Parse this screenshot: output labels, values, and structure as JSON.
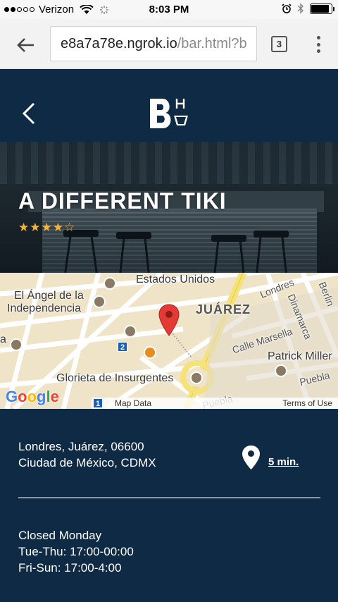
{
  "status_bar": {
    "carrier": "Verizon",
    "time": "8:03 PM",
    "signal_bars": 2,
    "battery_level": 0.9
  },
  "browser": {
    "url_main": "e8a7a78e.ngrok.io",
    "url_rest": "/bar.html?b",
    "tab_count": "3"
  },
  "venue": {
    "name": "A DIFFERENT TIKI",
    "rating": 4,
    "rating_max": 5
  },
  "map": {
    "labels": {
      "estados_unidos": "Estados Unidos",
      "angel": "El Ángel de la",
      "independencia": "Independencia",
      "juarez": "JUÁREZ",
      "londres": "Londres",
      "dinamarca": "Dinamarca",
      "berlin": "Berlin",
      "calle_marsella": "Calle Marsella",
      "patrick_miller": "Patrick Miller",
      "glorieta": "Glorieta de Insurgentes",
      "puebla_right": "Puebla",
      "puebla_bottom": "Puebla",
      "left_partial": "a"
    },
    "google": "Google",
    "map_data": "Map Data",
    "terms": "Terms of Use",
    "route_1": "1",
    "route_2": "2"
  },
  "details": {
    "address_line1": "Londres, Juárez, 06600",
    "address_line2": "Ciudad de México, CDMX",
    "walk_time": "5 min.",
    "hours": [
      "Closed Monday",
      "Tue-Thu: 17:00-00:00",
      "Fri-Sun: 17:00-4:00"
    ]
  },
  "colors": {
    "brand_navy": "#0e2a44",
    "star": "#f3b33b",
    "map_pin": "#e53935"
  }
}
